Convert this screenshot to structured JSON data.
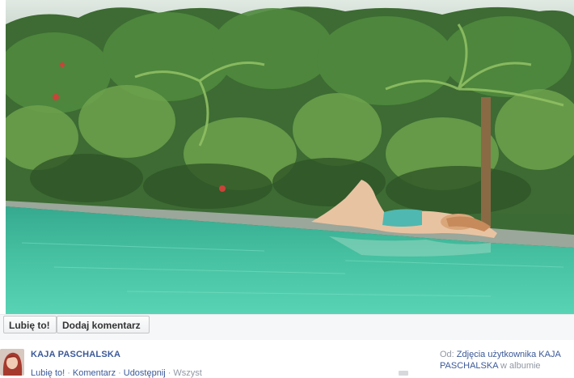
{
  "photo": {
    "icon": "pool-jungle-photo"
  },
  "actions": {
    "like_label": "Lubię to!",
    "comment_label": "Dodaj komentarz"
  },
  "post": {
    "author": "KAJA PASCHALSKA",
    "links": {
      "like": "Lubię to!",
      "comment": "Komentarz",
      "share": "Udostępnij",
      "extra": "Wszyst"
    },
    "source_prefix": "Od:",
    "source_link": "Zdjęcia użytkownika KAJA PASCHALSKA",
    "source_suffix": "w albumie"
  },
  "colors": {
    "link": "#3b5998",
    "muted": "#9197a3",
    "bar_bg": "#f6f7f9"
  }
}
